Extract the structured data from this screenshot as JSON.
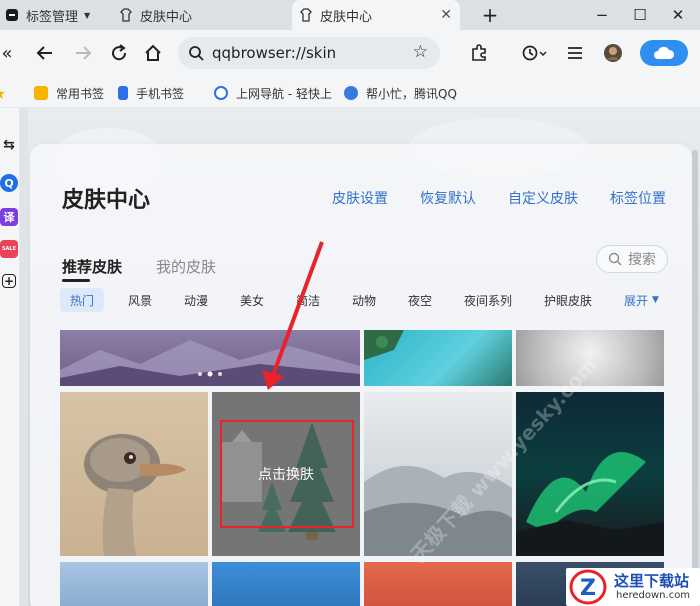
{
  "browser": {
    "tabs": [
      {
        "label": "标签管理",
        "icon": "tab-manager-icon"
      },
      {
        "label": "皮肤中心",
        "icon": "tshirt-icon"
      },
      {
        "label": "皮肤中心",
        "icon": "tshirt-icon",
        "active": true
      }
    ],
    "new_tab": "+",
    "window_buttons": [
      "−",
      "☐",
      "✕"
    ],
    "address": "qqbrowser://skin",
    "bookmarks": [
      {
        "label": "常用书签",
        "color": "#f5b400"
      },
      {
        "label": "手机书签",
        "color": "#2d6fe8"
      },
      {
        "label": "上网导航 - 轻快上",
        "color": "#2d6fe8"
      },
      {
        "label": "帮小忙，腾讯QQ",
        "color": "#2d6fe8"
      }
    ],
    "left_icons": [
      "«",
      "★",
      "⇆",
      "Q",
      "译",
      "SALE",
      "+"
    ]
  },
  "skin_center": {
    "title": "皮肤中心",
    "header_links": [
      "皮肤设置",
      "恢复默认",
      "自定义皮肤",
      "标签位置"
    ],
    "tabs": [
      "推荐皮肤",
      "我的皮肤"
    ],
    "search_label": "搜索",
    "categories": [
      "热门",
      "风景",
      "动漫",
      "美女",
      "简洁",
      "动物",
      "夜空",
      "夜间系列",
      "护眼皮肤"
    ],
    "expand_label": "展开",
    "hover_label": "点击换肤"
  },
  "watermark": "天极下载 www.yesky.com",
  "logo": {
    "main": "这里下载站",
    "sub": "heredown.com"
  },
  "colors": {
    "accent": "#3572c8",
    "red": "#e8232a"
  }
}
